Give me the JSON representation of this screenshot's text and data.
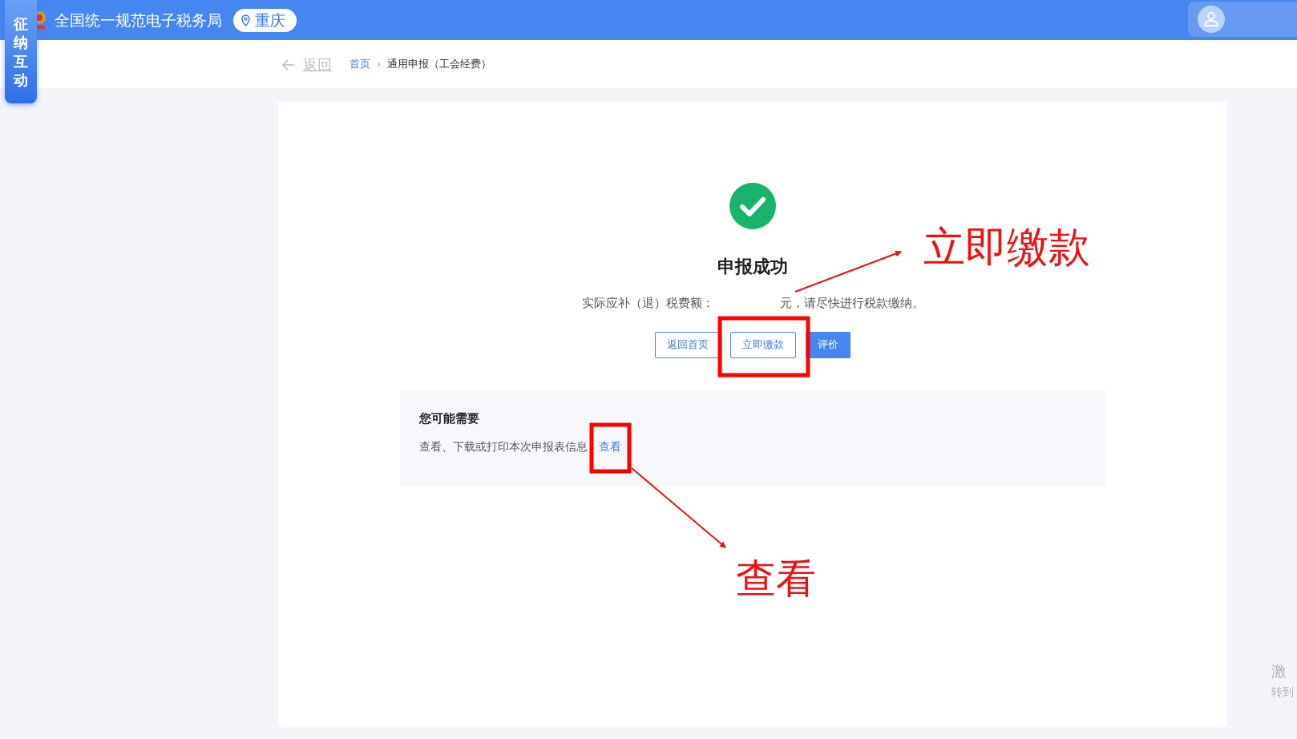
{
  "header": {
    "title": "全国统一规范电子税务局",
    "location": "重庆"
  },
  "side_tab": {
    "label": "征纳互动"
  },
  "breadcrumb": {
    "back": "返回",
    "items": [
      {
        "label": "首页",
        "link": true
      },
      {
        "label": "通用申报（工会经费）",
        "link": false
      }
    ],
    "separator": "›"
  },
  "result": {
    "title": "申报成功",
    "message_before": "实际应补（退）税费额：",
    "message_after": "元，请尽快进行税款缴纳。",
    "buttons": [
      {
        "label": "返回首页",
        "kind": "outline"
      },
      {
        "label": "立即缴款",
        "kind": "outline"
      },
      {
        "label": "评价",
        "kind": "primary"
      }
    ]
  },
  "suggestions": {
    "title": "您可能需要",
    "text": "查看、下载或打印本次申报表信息",
    "link": "查看"
  },
  "annotations": [
    {
      "label": "立即缴款"
    },
    {
      "label": "查看"
    }
  ],
  "watermark": {
    "line_1": "激",
    "line_2": "转到"
  }
}
